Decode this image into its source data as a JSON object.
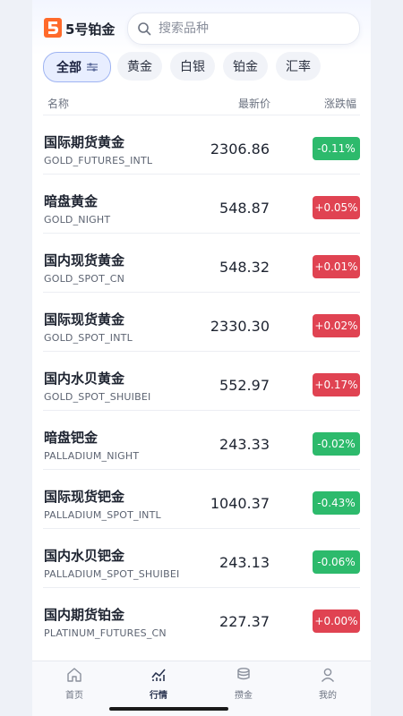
{
  "brand": {
    "logo_icon": "brand-5-logo-icon",
    "name": "5号铂金"
  },
  "search": {
    "placeholder": "搜索品种",
    "icon": "search-icon"
  },
  "chips": [
    {
      "label": "全部",
      "active": true
    },
    {
      "label": "黄金",
      "active": false
    },
    {
      "label": "白银",
      "active": false
    },
    {
      "label": "铂金",
      "active": false
    },
    {
      "label": "汇率",
      "active": false
    }
  ],
  "table": {
    "headers": {
      "name": "名称",
      "price": "最新价",
      "change": "涨跌幅"
    },
    "rows": [
      {
        "name": "国际期货黄金",
        "code": "GOLD_FUTURES_INTL",
        "price": "2306.86",
        "change": "-0.11%",
        "dir": "down"
      },
      {
        "name": "暗盘黄金",
        "code": "GOLD_NIGHT",
        "price": "548.87",
        "change": "+0.05%",
        "dir": "up"
      },
      {
        "name": "国内现货黄金",
        "code": "GOLD_SPOT_CN",
        "price": "548.32",
        "change": "+0.01%",
        "dir": "up"
      },
      {
        "name": "国际现货黄金",
        "code": "GOLD_SPOT_INTL",
        "price": "2330.30",
        "change": "+0.02%",
        "dir": "up"
      },
      {
        "name": "国内水贝黄金",
        "code": "GOLD_SPOT_SHUIBEI",
        "price": "552.97",
        "change": "+0.17%",
        "dir": "up"
      },
      {
        "name": "暗盘钯金",
        "code": "PALLADIUM_NIGHT",
        "price": "243.33",
        "change": "-0.02%",
        "dir": "down"
      },
      {
        "name": "国际现货钯金",
        "code": "PALLADIUM_SPOT_INTL",
        "price": "1040.37",
        "change": "-0.43%",
        "dir": "down"
      },
      {
        "name": "国内水贝钯金",
        "code": "PALLADIUM_SPOT_SHUIBEI",
        "price": "243.13",
        "change": "-0.06%",
        "dir": "down"
      },
      {
        "name": "国内期货铂金",
        "code": "PLATINUM_FUTURES_CN",
        "price": "227.37",
        "change": "+0.00%",
        "dir": "up"
      }
    ]
  },
  "colors": {
    "up": "#e04352",
    "down": "#2dba6c",
    "accent": "#9fb4f2"
  },
  "tabbar": [
    {
      "label": "首页",
      "icon": "home-icon",
      "active": false
    },
    {
      "label": "行情",
      "icon": "chart-icon",
      "active": true
    },
    {
      "label": "攒金",
      "icon": "coins-icon",
      "active": false
    },
    {
      "label": "我的",
      "icon": "user-icon",
      "active": false
    }
  ]
}
